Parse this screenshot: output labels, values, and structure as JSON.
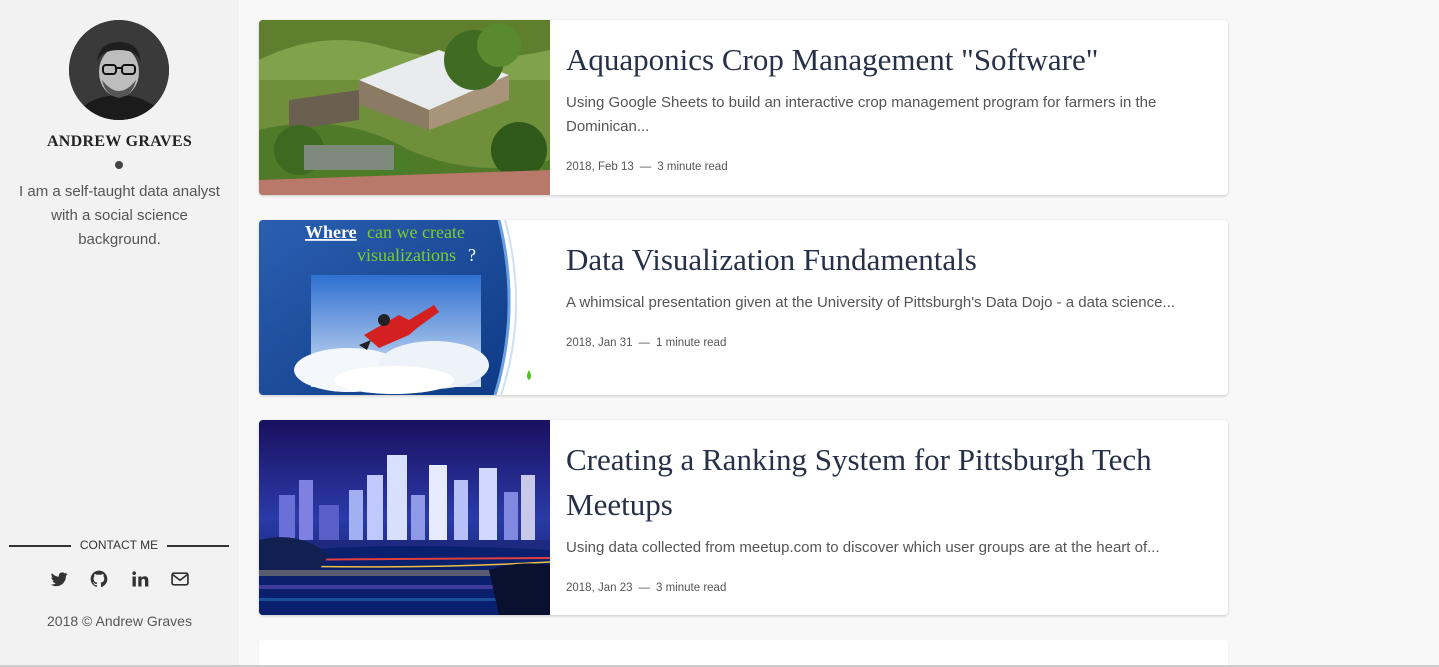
{
  "sidebar": {
    "name": "ANDREW GRAVES",
    "bio": "I am a self-taught data analyst with a social science background.",
    "contact_label": "CONTACT ME",
    "socials": [
      {
        "name": "twitter-icon",
        "label": "Twitter"
      },
      {
        "name": "github-icon",
        "label": "GitHub"
      },
      {
        "name": "linkedin-icon",
        "label": "LinkedIn"
      },
      {
        "name": "mail-icon",
        "label": "Email"
      }
    ],
    "footer": "2018 © Andrew Graves"
  },
  "posts": [
    {
      "title": "Aquaponics Crop Management \"Software\"",
      "excerpt": "Using Google Sheets to build an interactive crop management program for farmers in the Dominican...",
      "date": "2018, Feb 13",
      "separator": "—",
      "read_time": "3 minute read"
    },
    {
      "title": "Data Visualization Fundamentals",
      "excerpt": "A whimsical presentation given at the University of Pittsburgh's Data Dojo - a data science...",
      "date": "2018, Jan 31",
      "separator": "—",
      "read_time": "1 minute read",
      "thumb_text_1": "Where",
      "thumb_text_2": "can we create",
      "thumb_text_3": "visualizations",
      "thumb_text_4": "?"
    },
    {
      "title": "Creating a Ranking System for Pittsburgh Tech Meetups",
      "excerpt": "Using data collected from meetup.com to discover which user groups are at the heart of...",
      "date": "2018, Jan 23",
      "separator": "—",
      "read_time": "3 minute read"
    }
  ],
  "colors": {
    "title": "#263048",
    "sidebar_bg": "#f2f2f2",
    "page_bg": "#f8f8f8"
  }
}
